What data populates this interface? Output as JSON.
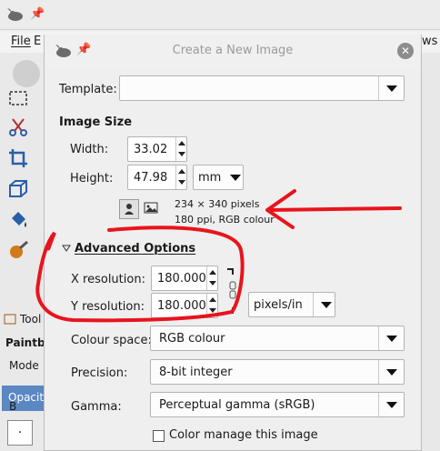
{
  "background_window": {
    "menu": {
      "file": "File",
      "edit_fragment": "E",
      "right_fragment": "ows"
    },
    "tool_options_tab": "Tool",
    "tool_name": "Paintbru",
    "mode_label": "Mode",
    "opacity_label": "Opacity",
    "brush_label": "B"
  },
  "dialog": {
    "title": "Create a New Image",
    "template_label": "Template:",
    "template_value": "",
    "image_size_header": "Image Size",
    "width_label": "Width:",
    "width_value": "33.02",
    "height_label": "Height:",
    "height_value": "47.98",
    "unit_value": "mm",
    "pixel_info_line1": "234 × 340 pixels",
    "pixel_info_line2": "180 ppi, RGB colour",
    "advanced_header": "Advanced Options",
    "x_res_label": "X resolution:",
    "x_res_value": "180.000",
    "y_res_label": "Y resolution:",
    "y_res_value": "180.000",
    "res_unit_value": "pixels/in",
    "colour_space_label": "Colour space:",
    "colour_space_value": "RGB colour",
    "precision_label": "Precision:",
    "precision_value": "8-bit integer",
    "gamma_label": "Gamma:",
    "gamma_value": "Perceptual gamma (sRGB)",
    "colour_manage_label": "Color manage this image"
  },
  "annotation_colors": {
    "red": "#e8141c"
  },
  "icons": [
    "gimp-wilber-icon",
    "pin-icon",
    "close-icon",
    "chain-icon",
    "portrait-icon",
    "landscape-icon",
    "expander-triangle-icon"
  ]
}
